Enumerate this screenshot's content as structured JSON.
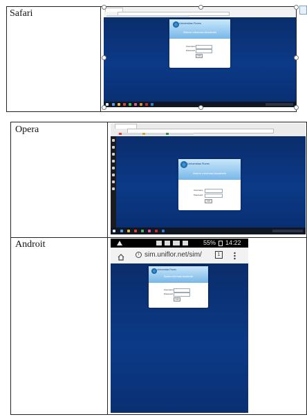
{
  "rows": [
    {
      "label": "Safari",
      "screenshot": {
        "card_site_name": "Universitas Flores",
        "card_title": "Sistem Informasi Akademik",
        "username_label": "Username",
        "password_label": "Password",
        "login_button": "Login"
      }
    },
    {
      "label": "Opera",
      "screenshot": {
        "card_site_name": "Universitas Flores",
        "card_title": "Sistem Informasi Akademik",
        "username_label": "Username",
        "password_label": "Password",
        "login_button": "Login"
      }
    },
    {
      "label": "Androit",
      "screenshot": {
        "status_signal": "55%",
        "status_time": "14:22",
        "url": "sim.uniflor.net/sim/",
        "tab_count": "1",
        "card_site_name": "Universitas Flores",
        "card_title": "Sistem Informasi Akademik",
        "username_label": "Username",
        "password_label": "Password",
        "login_button": "Login"
      }
    }
  ],
  "colors": {
    "site_background": "#0b3a87",
    "taskbar": "#101722",
    "android_status_bar": "#000000"
  },
  "icons": [
    "home-icon",
    "info-icon",
    "tab-counter-icon",
    "overflow-menu-icon",
    "windows-start-icon"
  ]
}
